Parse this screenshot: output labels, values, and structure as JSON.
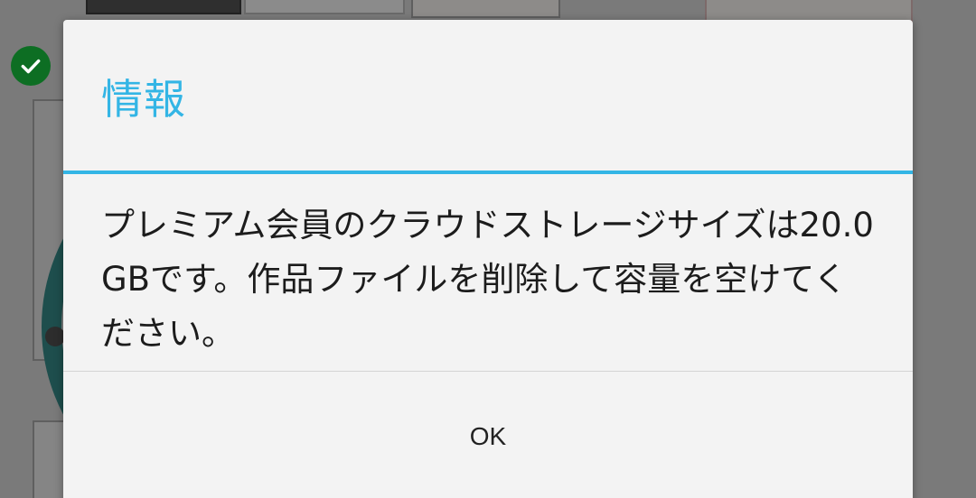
{
  "dialog": {
    "title": "情報",
    "message": "プレミアム会員のクラウドストレージサイズは20.0GBです。作品ファイルを削除して容量を空けてください。",
    "ok_label": "OK",
    "accent_color": "#33b5e5"
  },
  "background": {
    "check_badge_color": "#0d6e23",
    "icons": [
      "checkmark-icon"
    ]
  }
}
